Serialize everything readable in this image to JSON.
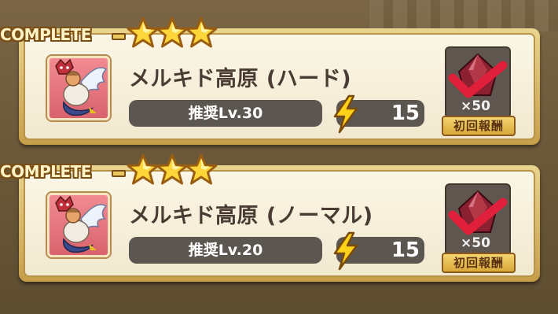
{
  "quests": [
    {
      "status": "COMPLETE",
      "stars": 3,
      "name": "メルキド高原 (ハード)",
      "recommended": "推奨Lv.30",
      "stamina": "15",
      "reward_qty": "×50",
      "reward_label": "初回報酬",
      "reward_claimed": true
    },
    {
      "status": "COMPLETE",
      "stars": 3,
      "name": "メルキド高原 (ノーマル)",
      "recommended": "推奨Lv.20",
      "stamina": "15",
      "reward_qty": "×50",
      "reward_label": "初回報酬",
      "reward_claimed": true
    }
  ],
  "colors": {
    "card_bg": "#fbf6e6",
    "bar_bg": "#5c5651",
    "gold": "#e9c960",
    "check": "#e0203a"
  },
  "icons": {
    "monster": "harpy-monster-icon",
    "stamina": "lightning-bolt-icon",
    "reward": "red-gem-icon",
    "claimed": "checkmark-icon"
  }
}
